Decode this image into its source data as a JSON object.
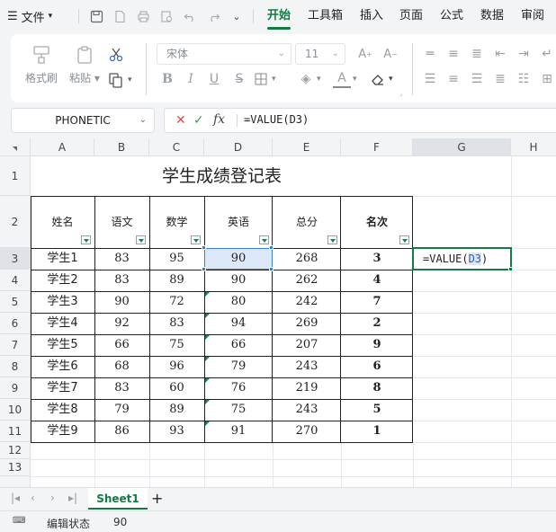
{
  "menubar": {
    "file_label": "文件",
    "tabs": [
      "开始",
      "工具箱",
      "插入",
      "页面",
      "公式",
      "数据",
      "审阅"
    ],
    "active_tab": "开始"
  },
  "ribbon": {
    "format_painter": "格式刷",
    "paste": "粘贴",
    "font_name": "宋体",
    "font_size": "11"
  },
  "formula_bar": {
    "name_box": "PHONETIC",
    "fx_label": "fx",
    "formula": "=VALUE(D3)"
  },
  "grid": {
    "columns": [
      "A",
      "B",
      "C",
      "D",
      "E",
      "F",
      "G",
      "H"
    ],
    "rows": [
      "1",
      "2",
      "3",
      "4",
      "5",
      "6",
      "7",
      "8",
      "9",
      "10",
      "11",
      "12",
      "13"
    ],
    "title": "学生成绩登记表",
    "headers": [
      "姓名",
      "语文",
      "数学",
      "英语",
      "总分",
      "名次"
    ],
    "data": [
      [
        "学生1",
        "83",
        "95",
        "90",
        "268",
        "3"
      ],
      [
        "学生2",
        "83",
        "89",
        "90",
        "262",
        "4"
      ],
      [
        "学生3",
        "90",
        "72",
        "80",
        "242",
        "7"
      ],
      [
        "学生4",
        "92",
        "83",
        "94",
        "269",
        "2"
      ],
      [
        "学生5",
        "66",
        "75",
        "66",
        "207",
        "9"
      ],
      [
        "学生6",
        "68",
        "96",
        "79",
        "243",
        "6"
      ],
      [
        "学生7",
        "83",
        "60",
        "76",
        "219",
        "8"
      ],
      [
        "学生8",
        "79",
        "89",
        "75",
        "243",
        "5"
      ],
      [
        "学生9",
        "86",
        "93",
        "91",
        "270",
        "1"
      ]
    ],
    "active_cell_prefix": "=VALUE(",
    "active_cell_ref": "D3",
    "active_cell_suffix": ")"
  },
  "sheets": {
    "tabs": [
      "Sheet1"
    ],
    "add_label": "+"
  },
  "status": {
    "mode": "编辑状态",
    "value": "90"
  },
  "colors": {
    "accent": "#107c41",
    "selection": "#3b7ddd"
  }
}
